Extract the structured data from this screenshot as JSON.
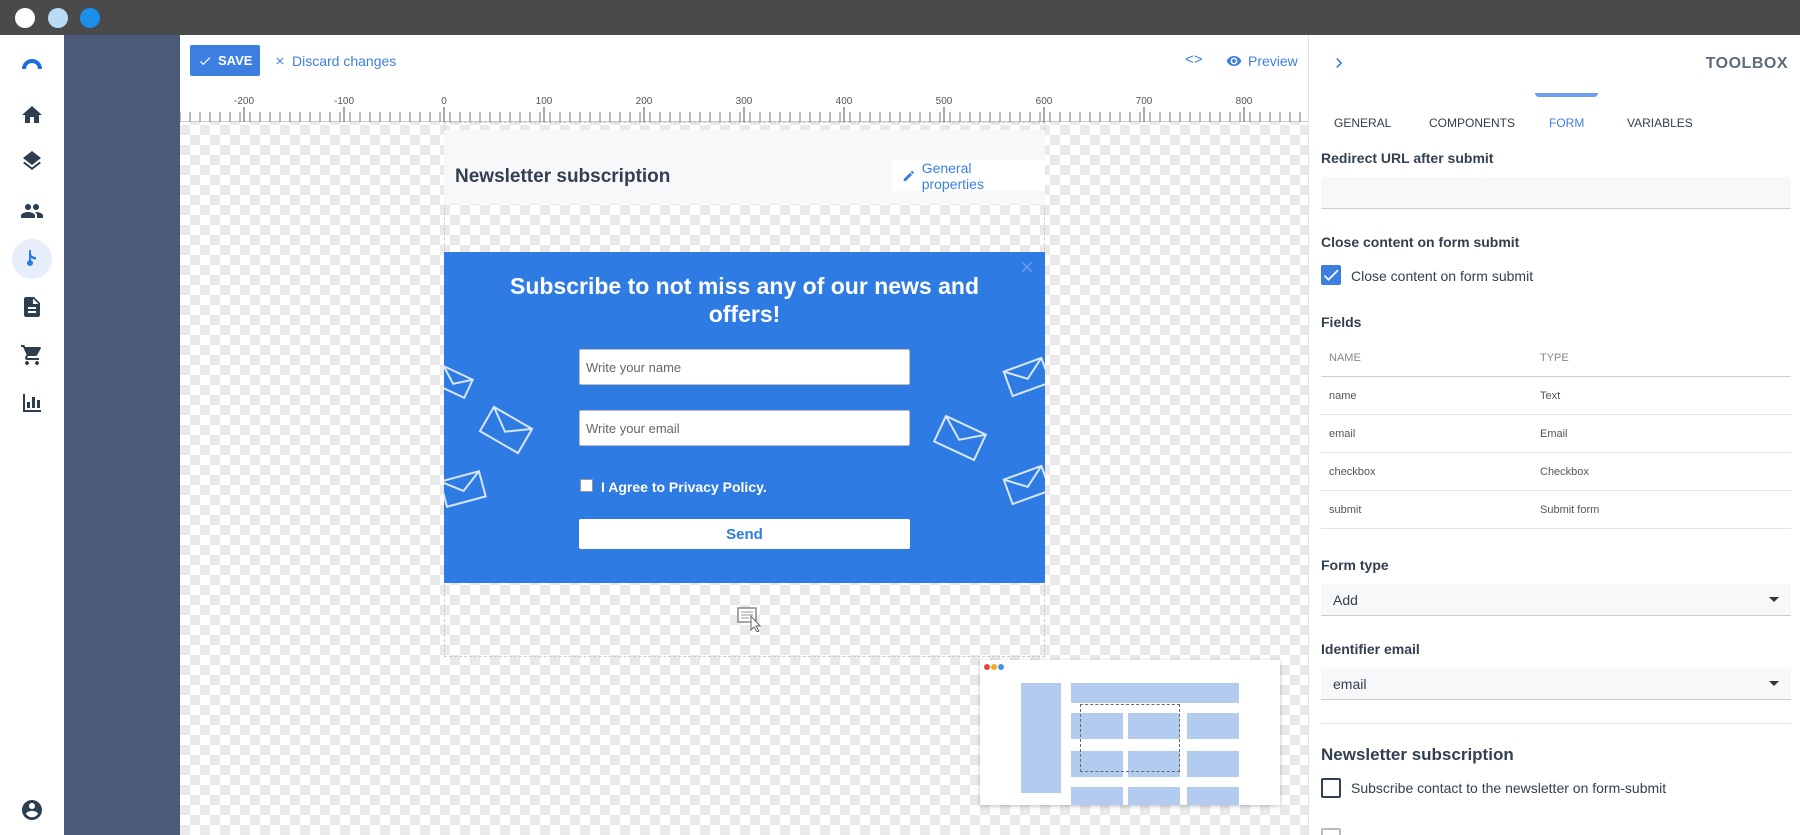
{
  "toolbar": {
    "save_label": "SAVE",
    "discard_label": "Discard changes",
    "code_label": "<>",
    "preview_label": "Preview"
  },
  "ruler": {
    "ticks": [
      "-200",
      "-100",
      "0",
      "100",
      "200",
      "300",
      "400",
      "500",
      "600",
      "700",
      "800"
    ]
  },
  "page": {
    "title": "Newsletter subscription",
    "general_properties_label": "General properties"
  },
  "popup": {
    "heading": "Subscribe to not miss any of our news and offers!",
    "name_placeholder": "Write your name",
    "email_placeholder": "Write your email",
    "privacy_label": "I Agree to Privacy Policy.",
    "send_label": "Send"
  },
  "nav": {
    "items": [
      "home-icon",
      "layers-icon",
      "contacts-icon",
      "flow-icon",
      "document-icon",
      "cart-icon",
      "chart-icon",
      "user-icon"
    ]
  },
  "toolbox": {
    "title": "TOOLBOX",
    "tabs": [
      "GENERAL",
      "COMPONENTS",
      "FORM",
      "VARIABLES"
    ],
    "active_tab": "FORM",
    "redirect_label": "Redirect URL after submit",
    "redirect_value": "",
    "close_section_label": "Close content on form submit",
    "close_checkbox_label": "Close content on form submit",
    "close_checked": true,
    "fields_label": "Fields",
    "fields_headers": [
      "NAME",
      "TYPE"
    ],
    "fields": [
      {
        "name": "name",
        "type": "Text"
      },
      {
        "name": "email",
        "type": "Email"
      },
      {
        "name": "checkbox",
        "type": "Checkbox"
      },
      {
        "name": "submit",
        "type": "Submit form"
      }
    ],
    "form_type_label": "Form type",
    "form_type_value": "Add",
    "identifier_label": "Identifier email",
    "identifier_value": "email",
    "newsletter_title": "Newsletter subscription",
    "newsletter_checkbox_label": "Subscribe contact to the newsletter on form-submit",
    "newsletter_checked": false
  },
  "colors": {
    "accent": "#3d7fe0",
    "popup_bg": "#2f7be4",
    "sidebar_dark": "#4b5a78",
    "titlebar": "#4a4a4a"
  }
}
